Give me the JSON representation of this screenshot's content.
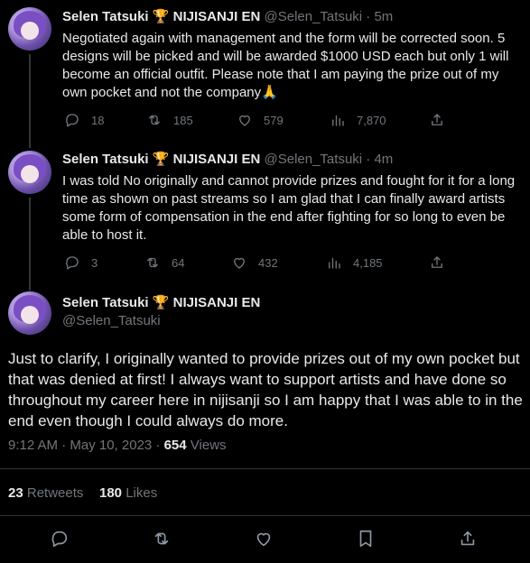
{
  "tweets": [
    {
      "name": "Selen Tatsuki",
      "badge": "🏆",
      "org": "NIJISANJI EN",
      "handle": "@Selen_Tatsuki",
      "time": "· 5m",
      "text": "Negotiated again with management and the form will be corrected soon. 5 designs will be picked and will be awarded $1000 USD each but only 1 will become an official outfit. Please note that I am paying the prize out of my own pocket and not the company🙏",
      "replies": "18",
      "retweets": "185",
      "likes": "579",
      "views": "7,870"
    },
    {
      "name": "Selen Tatsuki",
      "badge": "🏆",
      "org": "NIJISANJI EN",
      "handle": "@Selen_Tatsuki",
      "time": "· 4m",
      "text": "I was told No originally and cannot provide prizes and fought for it for a long time as shown on past streams so I am glad that I can finally award artists some form of compensation in the end after fighting for so long to even be able to host it.",
      "replies": "3",
      "retweets": "64",
      "likes": "432",
      "views": "4,185"
    }
  ],
  "main_tweet": {
    "name": "Selen Tatsuki",
    "badge": "🏆",
    "org": "NIJISANJI EN",
    "handle": "@Selen_Tatsuki",
    "text": "Just to clarify, I originally wanted to provide prizes out of my own pocket but that was denied at first! I always want to support artists and have done so throughout my career here in nijisanji so I am happy that I was able to in the end even though I could always do more.",
    "timestamp": "9:12 AM · May 10, 2023 · ",
    "views_count": "654",
    "views_label": " Views",
    "retweets_count": "23",
    "retweets_label": " Retweets",
    "likes_count": "180",
    "likes_label": " Likes"
  },
  "icons": {
    "reply": "reply-icon",
    "retweet": "retweet-icon",
    "like": "heart-icon",
    "views": "views-icon",
    "share": "share-icon",
    "bookmark": "bookmark-icon"
  },
  "colors": {
    "background": "#000000",
    "text": "#e7e9ea",
    "muted": "#71767b",
    "divider": "#2f3336",
    "badge": "#f2b01e"
  }
}
